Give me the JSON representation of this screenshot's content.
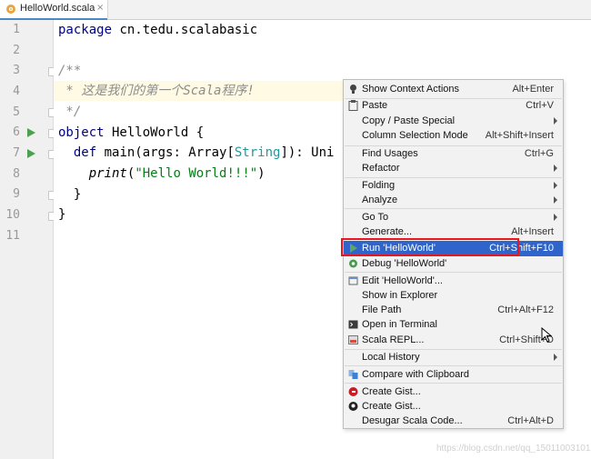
{
  "tab": {
    "title": "HelloWorld.scala",
    "close": "×",
    "icon": "scala-file-icon",
    "icon_glyph": "o"
  },
  "line_numbers": [
    "1",
    "2",
    "3",
    "4",
    "5",
    "6",
    "7",
    "8",
    "9",
    "10",
    "11"
  ],
  "code": {
    "l1_kw": "package",
    "l1_rest": " cn.tedu.scalabasic",
    "l3": "/**",
    "l4": " * 这是我们的第一个Scala程序!",
    "l5": " */",
    "l6_kw": "object",
    "l6_rest": " HelloWorld {",
    "l7_indent": "  ",
    "l7_kw": "def",
    "l7_a": " main(args: Array[",
    "l7_type": "String",
    "l7_b": "]): Uni",
    "l8_indent": "    ",
    "l8_fn": "print",
    "l8_a": "(",
    "l8_str": "\"Hello World!!!\"",
    "l8_b": ")",
    "l9": "  }",
    "l10": "}"
  },
  "menu": {
    "items": [
      {
        "label": "Show Context Actions",
        "shortcut": "Alt+Enter",
        "icon": "lightbulb-icon"
      },
      {
        "label": "Paste",
        "shortcut": "Ctrl+V",
        "icon": "clipboard-icon"
      },
      {
        "label": "Copy / Paste Special",
        "shortcut": ""
      },
      {
        "label": "Column Selection Mode",
        "shortcut": "Alt+Shift+Insert"
      },
      {
        "label": "Find Usages",
        "shortcut": "Ctrl+G"
      },
      {
        "label": "Refactor",
        "shortcut": ""
      },
      {
        "label": "Folding",
        "shortcut": ""
      },
      {
        "label": "Analyze",
        "shortcut": ""
      },
      {
        "label": "Go To",
        "shortcut": ""
      },
      {
        "label": "Generate...",
        "shortcut": "Alt+Insert"
      },
      {
        "label": "Run 'HelloWorld'",
        "shortcut": "Ctrl+Shift+F10",
        "icon": "run-icon"
      },
      {
        "label": "Debug 'HelloWorld'",
        "shortcut": "",
        "icon": "debug-icon"
      },
      {
        "label": "Edit 'HelloWorld'...",
        "shortcut": "",
        "icon": "edit-config-icon"
      },
      {
        "label": "Show in Explorer",
        "shortcut": ""
      },
      {
        "label": "File Path",
        "shortcut": "Ctrl+Alt+F12"
      },
      {
        "label": "Open in Terminal",
        "shortcut": "",
        "icon": "terminal-icon"
      },
      {
        "label": "Scala REPL...",
        "shortcut": "Ctrl+Shift+D",
        "icon": "scala-repl-icon"
      },
      {
        "label": "Local History",
        "shortcut": ""
      },
      {
        "label": "Compare with Clipboard",
        "shortcut": "",
        "icon": "compare-icon"
      },
      {
        "label": "Create Gist...",
        "shortcut": "",
        "icon": "gitee-icon"
      },
      {
        "label": "Create Gist...",
        "shortcut": "",
        "icon": "github-icon"
      },
      {
        "label": "Desugar Scala Code...",
        "shortcut": "Ctrl+Alt+D"
      }
    ]
  },
  "watermark": "https://blog.csdn.net/qq_15011003101",
  "colors": {
    "selection": "#2f65ca",
    "highlight_box": "#e8171f",
    "run_green": "#4ca14f"
  }
}
